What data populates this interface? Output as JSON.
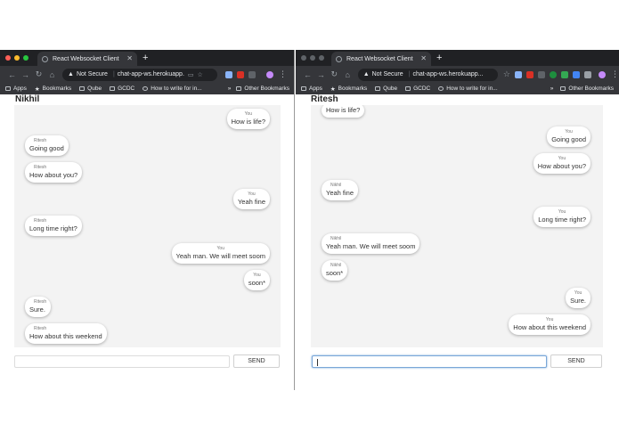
{
  "browser": {
    "tab_title": "React Websocket Client",
    "new_tab_symbol": "+",
    "security_label": "Not Secure",
    "url_left": "chat-app-ws.herokuapp.",
    "url_right": "chat-app-ws.herokuapp...",
    "bookmarks": [
      {
        "label": "Apps"
      },
      {
        "label": "Bookmarks"
      },
      {
        "label": "Qube"
      },
      {
        "label": "GCDC"
      },
      {
        "label": "How to write for in..."
      }
    ],
    "overflow": "»",
    "other_bookmarks": "Other Bookmarks"
  },
  "windows": [
    {
      "user": "Nikhil",
      "messages": [
        {
          "sender": "You",
          "text": "How is life?",
          "mine": true
        },
        {
          "sender": "Ritesh",
          "text": "Going good",
          "mine": false
        },
        {
          "sender": "Ritesh",
          "text": "How about you?",
          "mine": false
        },
        {
          "sender": "You",
          "text": "Yeah fine",
          "mine": true
        },
        {
          "sender": "Ritesh",
          "text": "Long time right?",
          "mine": false
        },
        {
          "sender": "You",
          "text": "Yeah man. We will meet soom",
          "mine": true
        },
        {
          "sender": "You",
          "text": "soon*",
          "mine": true
        },
        {
          "sender": "Ritesh",
          "text": "Sure.",
          "mine": false
        },
        {
          "sender": "Ritesh",
          "text": "How about this weekend",
          "mine": false
        }
      ],
      "input_value": "",
      "send_label": "SEND"
    },
    {
      "user": "Ritesh",
      "messages": [
        {
          "sender": "",
          "text": "How is life?",
          "mine": false
        },
        {
          "sender": "You",
          "text": "Going good",
          "mine": true
        },
        {
          "sender": "You",
          "text": "How about you?",
          "mine": true
        },
        {
          "sender": "Nikhil",
          "text": "Yeah fine",
          "mine": false
        },
        {
          "sender": "You",
          "text": "Long time right?",
          "mine": true
        },
        {
          "sender": "Nikhil",
          "text": "Yeah man. We will meet soom",
          "mine": false
        },
        {
          "sender": "Nikhil",
          "text": "soon*",
          "mine": false
        },
        {
          "sender": "You",
          "text": "Sure.",
          "mine": true
        },
        {
          "sender": "You",
          "text": "How about this weekend",
          "mine": true
        }
      ],
      "input_value": "",
      "send_label": "SEND"
    }
  ],
  "colors": {
    "titlebar": "#202124",
    "toolbar": "#35363a",
    "chat_bg": "#f3f3f3",
    "traffic_red": "#ff5f57",
    "traffic_yellow": "#febc2e",
    "traffic_green": "#28c840"
  },
  "icons": [
    "back-icon",
    "forward-icon",
    "reload-icon",
    "home-icon",
    "warning-icon",
    "star-icon",
    "bookmark-folder-icon",
    "profile-icon",
    "menu-icon"
  ]
}
